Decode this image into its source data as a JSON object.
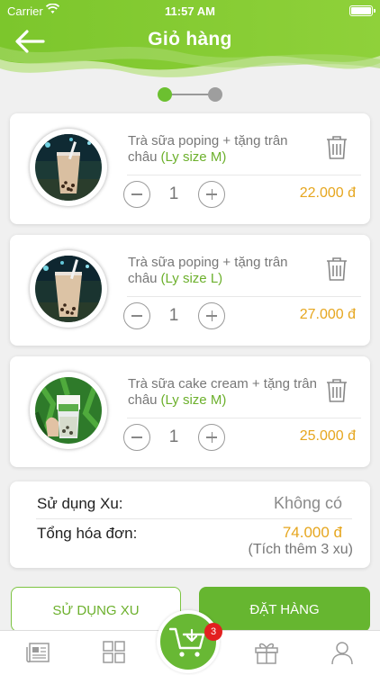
{
  "status_bar": {
    "carrier": "Carrier",
    "time": "11:57 AM"
  },
  "header": {
    "title": "Giỏ hàng"
  },
  "steps": {
    "current": 1,
    "total": 2
  },
  "cart": {
    "items": [
      {
        "name": "Trà sữa poping + tặng trân châu",
        "size": "(Ly size M)",
        "quantity": "1",
        "price": "22.000 đ"
      },
      {
        "name": "Trà sữa poping + tặng trân châu",
        "size": "(Ly size L)",
        "quantity": "1",
        "price": "27.000 đ"
      },
      {
        "name": "Trà sữa cake cream + tặng trân châu",
        "size": "(Ly size M)",
        "quantity": "1",
        "price": "25.000 đ"
      }
    ]
  },
  "summary": {
    "xu_label": "Sử dụng Xu:",
    "xu_value": "Không có",
    "total_label": "Tổng hóa đơn:",
    "total_value": "74.000 đ",
    "bonus_note": "(Tích thêm 3 xu)"
  },
  "actions": {
    "use_xu_label": "SỬ DỤNG XU",
    "order_label": "ĐẶT HÀNG"
  },
  "tabbar": {
    "cart_badge": "3",
    "tabs": [
      {
        "icon": "newspaper-icon"
      },
      {
        "icon": "grid-menu-icon"
      },
      {
        "icon": "cart-download-icon"
      },
      {
        "icon": "gift-icon"
      },
      {
        "icon": "user-icon"
      }
    ]
  },
  "colors": {
    "brand_green": "#66b630",
    "price_orange": "#e6a61e",
    "badge_red": "#e32020"
  }
}
